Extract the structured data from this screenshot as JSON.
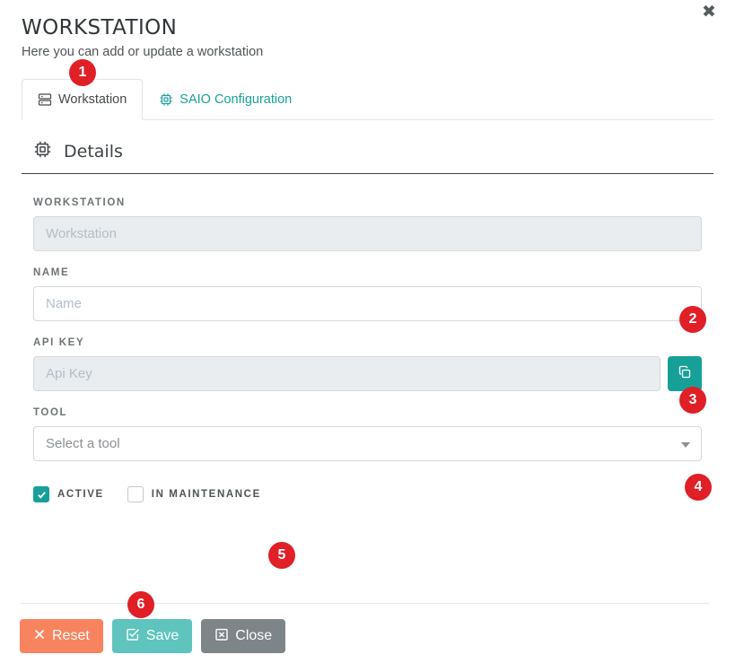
{
  "window": {
    "close_icon": "close-x-icon"
  },
  "header": {
    "title": "WORKSTATION",
    "subtitle": "Here you can add or update a workstation"
  },
  "tabs": [
    {
      "label": "Workstation",
      "icon": "server-icon",
      "active": true
    },
    {
      "label": "SAIO Configuration",
      "icon": "chip-icon",
      "active": false
    }
  ],
  "section": {
    "title": "Details",
    "icon": "chip-icon"
  },
  "fields": {
    "workstation": {
      "label": "WORKSTATION",
      "placeholder": "Workstation",
      "value": "",
      "disabled": true
    },
    "name": {
      "label": "NAME",
      "placeholder": "Name",
      "value": "",
      "disabled": false
    },
    "api_key": {
      "label": "API KEY",
      "placeholder": "Api Key",
      "value": "",
      "disabled": true,
      "copy_button_icon": "copy-icon"
    },
    "tool": {
      "label": "TOOL",
      "selected": "Select a tool",
      "caret_icon": "chevron-down-icon"
    }
  },
  "checkboxes": [
    {
      "label": "ACTIVE",
      "checked": true
    },
    {
      "label": "IN MAINTENANCE",
      "checked": false
    }
  ],
  "footer": {
    "reset_label": "Reset",
    "reset_icon": "x-icon",
    "save_label": "Save",
    "save_icon": "check-square-icon",
    "close_label": "Close",
    "close_icon": "x-square-icon"
  },
  "badges": [
    {
      "number": "1"
    },
    {
      "number": "2"
    },
    {
      "number": "3"
    },
    {
      "number": "4"
    },
    {
      "number": "5"
    },
    {
      "number": "6"
    }
  ],
  "colors": {
    "teal_accent": "#17a098",
    "teal_save": "#5ec4bd",
    "orange_reset": "#f8845f",
    "gray_close": "#7e8589",
    "badge_red": "#e01f26"
  }
}
